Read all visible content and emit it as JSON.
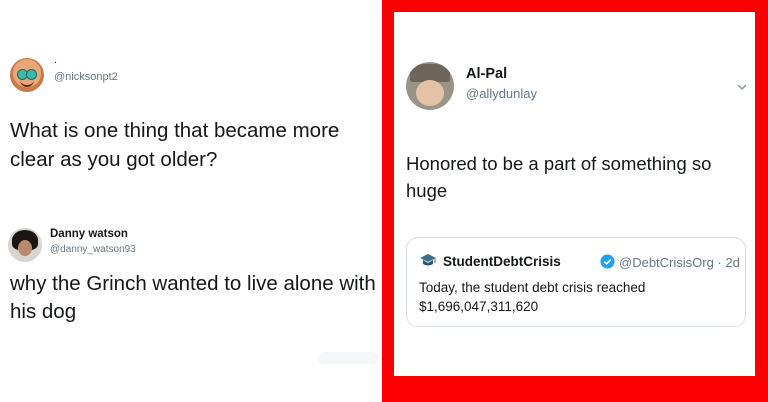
{
  "left_tweet": {
    "author_dot": ".",
    "handle": "@nicksonpt2",
    "text": "What is one thing that became more clear as you got older?"
  },
  "reply": {
    "name": "Danny watson",
    "handle": "@danny_watson93",
    "text": "why the Grinch wanted to live alone with his dog"
  },
  "right_tweet": {
    "name": "Al-Pal",
    "handle": "@allydunlay",
    "text": "Honored to be a part of something so huge",
    "quoted": {
      "name": "StudentDebtCrisis",
      "handle_time": "@DebtCrisisOrg · 2d",
      "text": "Today, the student debt crisis reached $1,696,047,311,620"
    }
  },
  "colors": {
    "frame_red": "#fa0000",
    "verified_blue": "#1da1f2",
    "muted_text": "#657786"
  },
  "icons": [
    "chevron-down-icon",
    "verified-badge-icon",
    "graduation-cap-icon"
  ]
}
